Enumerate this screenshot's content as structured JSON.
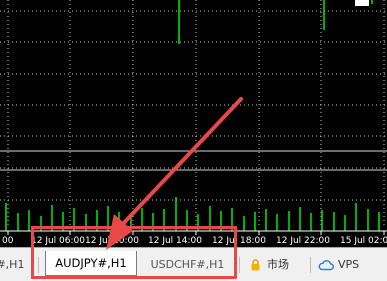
{
  "chart": {
    "background_color": "#000000",
    "grid_color": "#c8c8c8",
    "bar_color": "#00e000",
    "time_labels": [
      "00",
      "12 Jul 06:00",
      "12 Jul 10:00",
      "12 Jul 14:00",
      "12 Jul 18:00",
      "12 Jul 22:00",
      "15 Jul 02:00"
    ]
  },
  "tabs": [
    {
      "label": "D#,H1",
      "state": "partial"
    },
    {
      "label": "AUDJPY#,H1",
      "state": "active"
    },
    {
      "label": "USDCHF#,H1",
      "state": "inactive"
    }
  ],
  "toolbar": {
    "market_label": "市场",
    "market_icon": "lock-icon",
    "vps_label": "VPS",
    "vps_icon": "cloud-icon"
  },
  "annotation": {
    "color": "#e84848",
    "shapes": [
      "highlight-box",
      "arrow"
    ]
  }
}
